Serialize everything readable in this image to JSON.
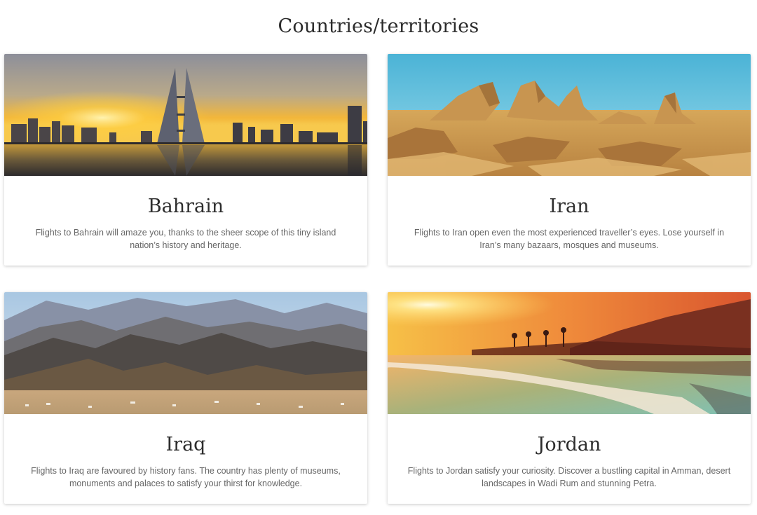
{
  "page": {
    "title": "Countries/territories"
  },
  "cards": [
    {
      "title": "Bahrain",
      "description": "Flights to Bahrain will amaze you, thanks to the sheer scope of this tiny island nation’s history and heritage.",
      "image": "bahrain-skyline-sunset"
    },
    {
      "title": "Iran",
      "description": "Flights to Iran open even the most experienced traveller’s eyes. Lose yourself in Iran’s many bazaars, mosques and museums.",
      "image": "iran-desert-rock-formations"
    },
    {
      "title": "Iraq",
      "description": "Flights to Iraq are favoured by history fans. The country has plenty of museums, monuments and palaces to satisfy your thirst for knowledge.",
      "image": "iraq-mountain-valley"
    },
    {
      "title": "Jordan",
      "description": "Flights to Jordan satisfy your curiosity. Discover a bustling capital in Amman, desert landscapes in Wadi Rum and stunning Petra.",
      "image": "jordan-dead-sea-sunset"
    }
  ]
}
